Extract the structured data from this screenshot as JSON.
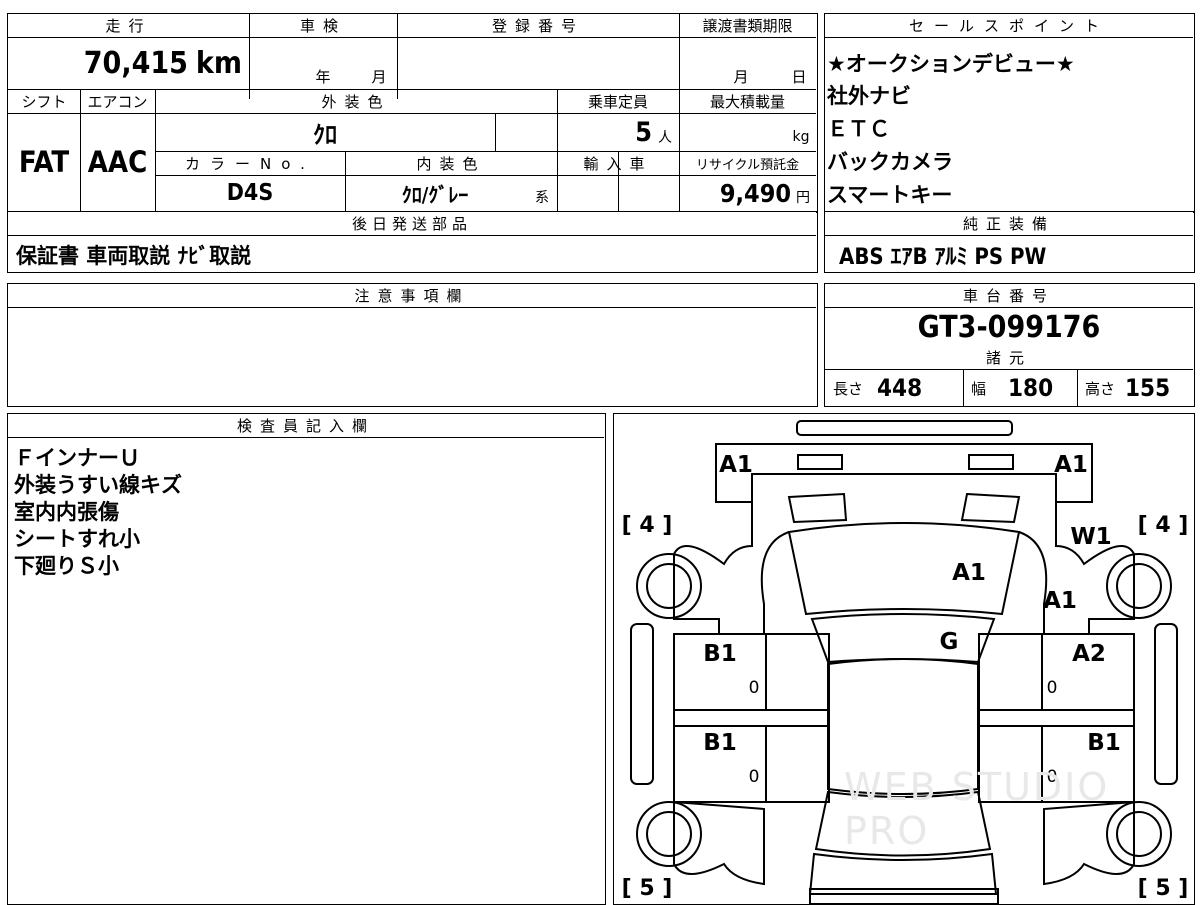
{
  "vehicle": {
    "mileage_label": "走行",
    "mileage": "70,415",
    "mileage_unit": "km",
    "inspection_label": "車検",
    "inspection_year_unit": "年",
    "inspection_month_unit": "月",
    "registration_label": "登録番号",
    "transfer_deadline_label": "譲渡書類期限",
    "transfer_month_unit": "月",
    "transfer_day_unit": "日",
    "shift_label": "シフト",
    "shift": "FAT",
    "ac_label": "エアコン",
    "ac": "AAC",
    "exterior_color_label": "外装色",
    "exterior_color": "ｸﾛ",
    "capacity_label": "乗車定員",
    "capacity": "5",
    "capacity_unit": "人",
    "max_load_label": "最大積載量",
    "max_load_unit": "kg",
    "color_no_label": "カラーNo.",
    "color_no": "D4S",
    "interior_color_label": "内装色",
    "interior_color": "ｸﾛ/ｸﾞﾚｰ",
    "interior_suffix": "系",
    "import_label": "輸入車",
    "recycle_label": "リサイクル預託金",
    "recycle_fee": "9,490",
    "recycle_unit": "円"
  },
  "later_shipping": {
    "label": "後日発送部品",
    "items": "保証書 車両取説 ﾅﾋﾞ取説"
  },
  "sales_points": {
    "label": "セールスポイント",
    "items": [
      "★オークションデビュー★",
      "社外ナビ",
      "ＥＴＣ",
      "バックカメラ",
      "スマートキー"
    ]
  },
  "standard_equipment": {
    "label": "純正装備",
    "items": "ABS ｴｱB ｱﾙﾐ PS PW"
  },
  "notes": {
    "label": "注意事項欄"
  },
  "chassis": {
    "label": "車台番号",
    "number": "GT3-099176"
  },
  "specs": {
    "label": "諸元",
    "length_label": "長さ",
    "length": "448",
    "width_label": "幅",
    "width": "180",
    "height_label": "高さ",
    "height": "155"
  },
  "inspector": {
    "label": "検査員記入欄",
    "lines": [
      "ＦインナーＵ",
      "外装うすい線キズ",
      "室内内張傷",
      "シートすれ小",
      "下廻りＳ小"
    ]
  },
  "diagram": {
    "tire_front_left": "[ 4 ]",
    "tire_front_right": "[ 4 ]",
    "tire_rear_left": "[ 5 ]",
    "tire_rear_right": "[ 5 ]",
    "marks": {
      "front_bumper_left": "A1",
      "front_bumper_right": "A1",
      "front_fender_right": "W1",
      "hood": "A1",
      "front_right_pillar": "A1",
      "windshield": "G",
      "front_left_door": "B1",
      "front_right_door": "A2",
      "rear_left_door": "B1",
      "rear_right_door": "B1",
      "door_zero_fl": "0",
      "door_zero_fr": "0",
      "door_zero_rl": "0",
      "door_zero_rr": "0"
    },
    "watermark": "WEB STUDIO PRO"
  }
}
